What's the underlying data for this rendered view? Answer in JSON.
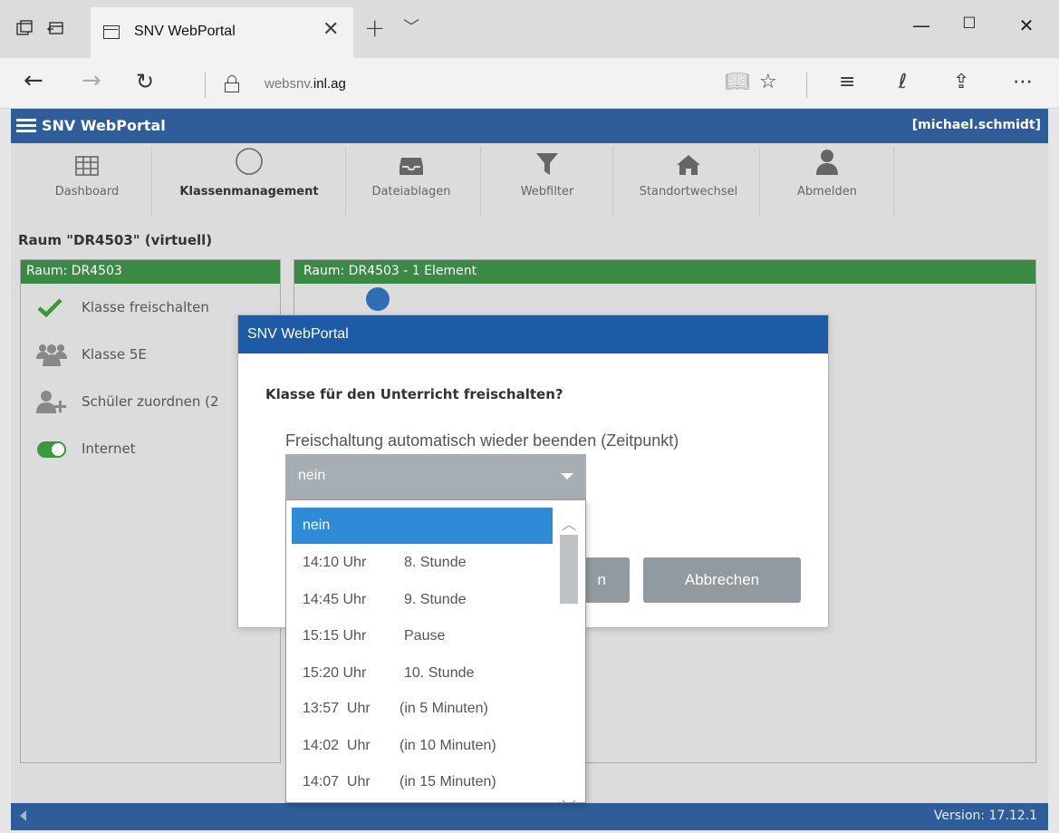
{
  "browser": {
    "tab_title": "SNV WebPortal",
    "url_prefix": "websnv.",
    "url_domain": "inl.ag"
  },
  "app": {
    "title": "SNV WebPortal",
    "user": "[michael.schmidt]",
    "accent_color": "#2e5d99"
  },
  "toolbar": {
    "items": [
      {
        "label": "Dashboard",
        "icon": "grid-icon"
      },
      {
        "label": "Klassenmanagement",
        "icon": "circle-icon",
        "active": true
      },
      {
        "label": "Dateiablagen",
        "icon": "inbox-icon"
      },
      {
        "label": "Webfilter",
        "icon": "filter-icon"
      },
      {
        "label": "Standortwechsel",
        "icon": "home-icon"
      },
      {
        "label": "Abmelden",
        "icon": "user-icon"
      }
    ]
  },
  "room": {
    "title": "Raum \"DR4503\" (virtuell)",
    "left_panel_title": "Raum: DR4503",
    "right_panel_title": "Raum: DR4503 - 1 Element",
    "left_items": [
      {
        "label": "Klasse freischalten",
        "icon": "checkmark-icon"
      },
      {
        "label": "Klasse 5E",
        "icon": "group-icon"
      },
      {
        "label": "Schüler zuordnen (2",
        "icon": "add-user-icon"
      },
      {
        "label": "Internet",
        "icon": "toggle-icon"
      }
    ]
  },
  "modal": {
    "title": "SNV WebPortal",
    "question": "Klasse für den Unterricht freischalten?",
    "select_label": "Freischaltung automatisch wieder beenden (Zeitpunkt)",
    "selected_value": "nein",
    "ok_button_partial": "n",
    "cancel_button": "Abbrechen"
  },
  "dropdown": {
    "options": [
      {
        "time": "nein",
        "desc": ""
      },
      {
        "time": "14:10 Uhr",
        "desc": "8. Stunde"
      },
      {
        "time": "14:45 Uhr",
        "desc": "9. Stunde"
      },
      {
        "time": "15:15 Uhr",
        "desc": "Pause"
      },
      {
        "time": "15:20 Uhr",
        "desc": "10. Stunde"
      },
      {
        "time": "13:57  Uhr",
        "desc": "(in 5 Minuten)"
      },
      {
        "time": "14:02  Uhr",
        "desc": "(in 10 Minuten)"
      },
      {
        "time": "14:07  Uhr",
        "desc": "(in 15 Minuten)"
      }
    ]
  },
  "status": {
    "version": "Version: 17.12.1"
  }
}
